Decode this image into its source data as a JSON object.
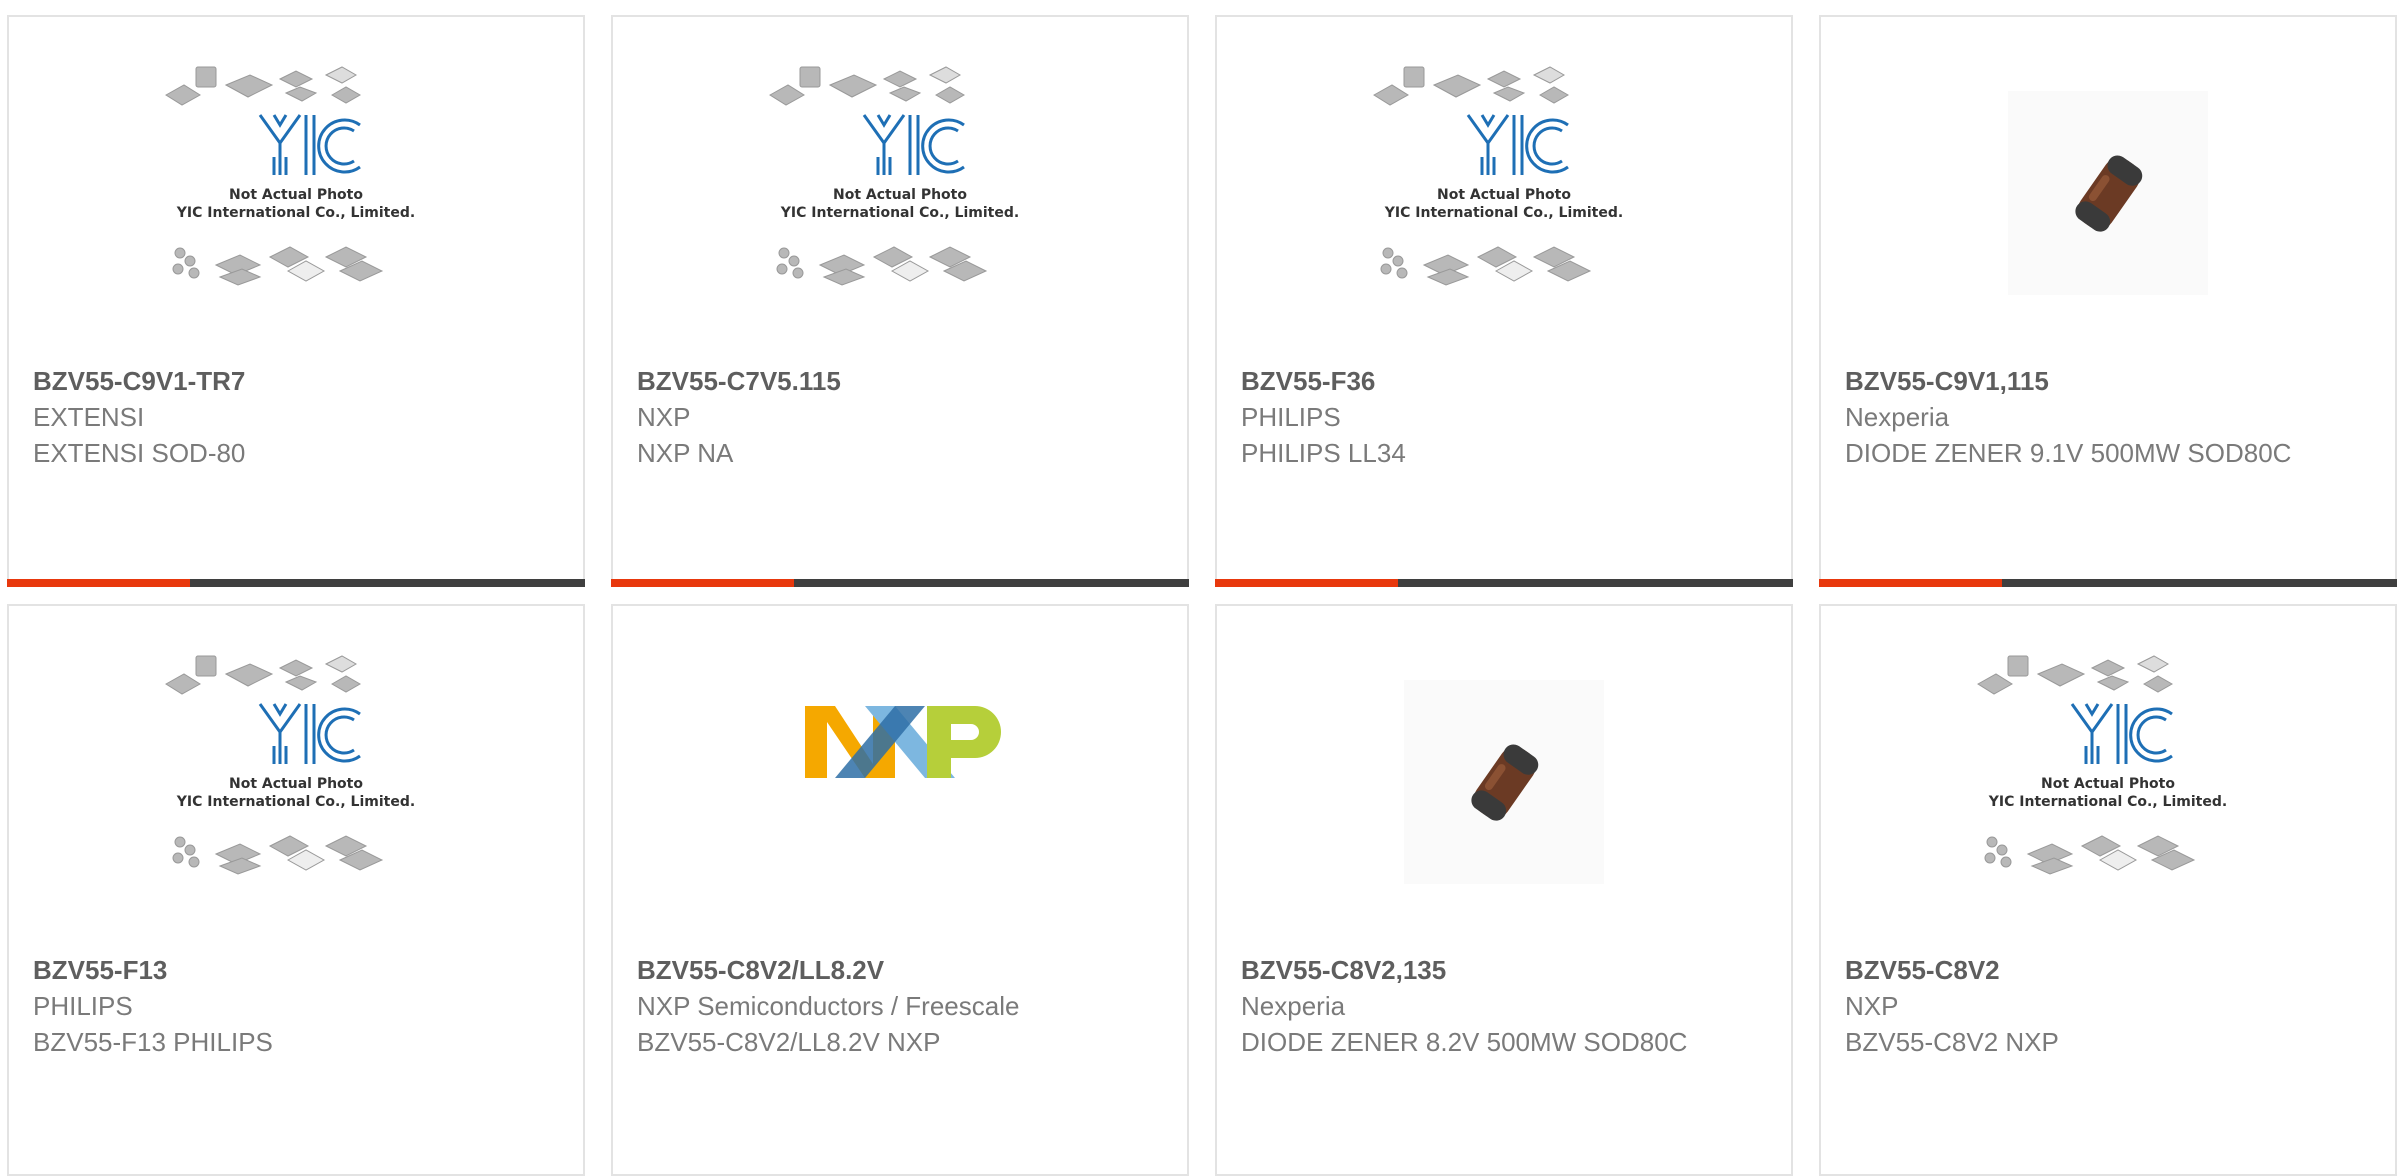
{
  "colors": {
    "accent": "#e8380d",
    "bar_dark": "#3f3f3f"
  },
  "placeholder": {
    "line1": "Not Actual Photo",
    "line2": "YIC International Co., Limited.",
    "logo_text": "YIC"
  },
  "products": [
    {
      "part": "BZV55-C9V1-TR7",
      "manufacturer": "EXTENSI",
      "description": "EXTENSI SOD-80",
      "image": "yic-placeholder"
    },
    {
      "part": "BZV55-C7V5.115",
      "manufacturer": "NXP",
      "description": "NXP NA",
      "image": "yic-placeholder"
    },
    {
      "part": "BZV55-F36",
      "manufacturer": "PHILIPS",
      "description": "PHILIPS LL34",
      "image": "yic-placeholder"
    },
    {
      "part": "BZV55-C9V1,115",
      "manufacturer": "Nexperia",
      "description": "DIODE ZENER 9.1V 500MW SOD80C",
      "image": "diode-photo"
    },
    {
      "part": "BZV55-F13",
      "manufacturer": "PHILIPS",
      "description": "BZV55-F13 PHILIPS",
      "image": "yic-placeholder"
    },
    {
      "part": "BZV55-C8V2/LL8.2V",
      "manufacturer": "NXP Semiconductors / Freescale",
      "description": "BZV55-C8V2/LL8.2V NXP",
      "image": "nxp-logo"
    },
    {
      "part": "BZV55-C8V2,135",
      "manufacturer": "Nexperia",
      "description": "DIODE ZENER 8.2V 500MW SOD80C",
      "image": "diode-photo"
    },
    {
      "part": "BZV55-C8V2",
      "manufacturer": "NXP",
      "description": "BZV55-C8V2 NXP",
      "image": "yic-placeholder"
    }
  ]
}
